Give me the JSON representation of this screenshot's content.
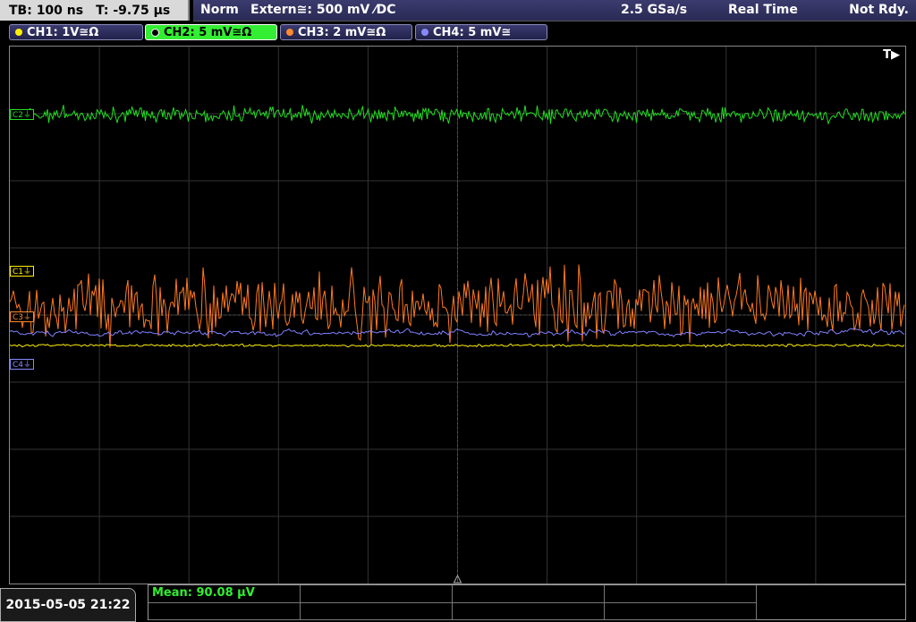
{
  "status_bar": {
    "timebase": "TB: 100 ns",
    "trigger_time": "T: -9.75 µs",
    "trigger_mode": "Norm",
    "trigger_source": "Extern≅: 500 mV ⁄DC",
    "sample_rate": "2.5 GSa/s",
    "acq_mode": "Real Time",
    "acq_state": "Not Rdy."
  },
  "channels": [
    {
      "label": "CH1: 1V≅Ω",
      "color": "#ffee00",
      "active": false
    },
    {
      "label": "CH2: 5 mV≅Ω",
      "color": "#22dd22",
      "active": true
    },
    {
      "label": "CH3: 2 mV≅Ω",
      "color": "#ff8a30",
      "active": false
    },
    {
      "label": "CH4: 5 mV≅",
      "color": "#8888ff",
      "active": false
    }
  ],
  "plot": {
    "trigger_marker": "T▶",
    "labels": {
      "c1": "C1⏚",
      "c2": "C2⏚",
      "c3": "C3⏚",
      "c4": "C4⏚"
    }
  },
  "footer": {
    "datetime": "2015-05-05 21:22",
    "measurement": "Mean: 90.08 µV"
  }
}
